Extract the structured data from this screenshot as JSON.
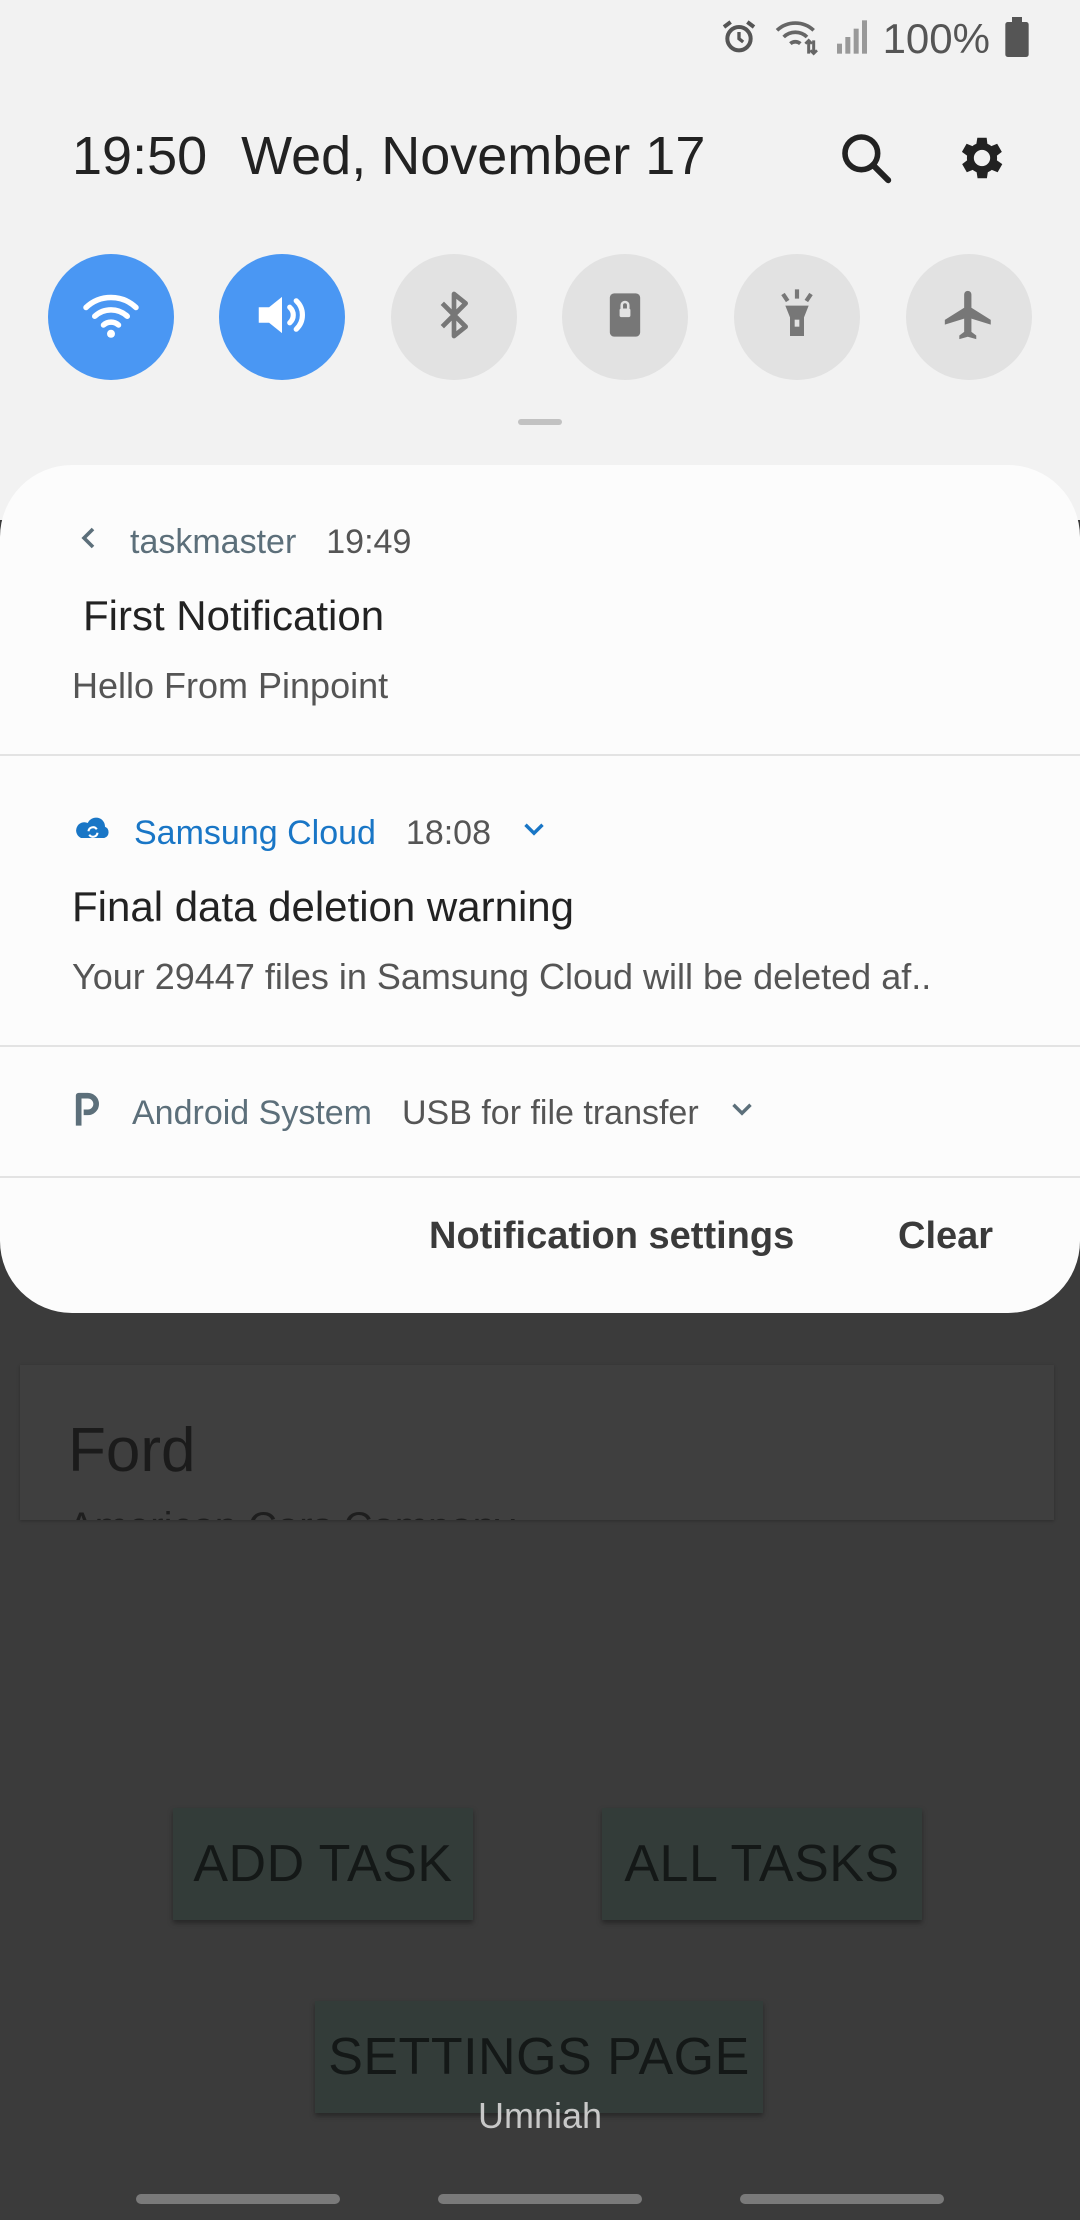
{
  "status": {
    "battery": "100%"
  },
  "header": {
    "time": "19:50",
    "date": "Wed, November 17"
  },
  "quick_settings": [
    {
      "name": "wifi",
      "state": "on"
    },
    {
      "name": "sound",
      "state": "on"
    },
    {
      "name": "bluetooth",
      "state": "off"
    },
    {
      "name": "portrait-lock",
      "state": "off"
    },
    {
      "name": "flashlight",
      "state": "off"
    },
    {
      "name": "airplane-mode",
      "state": "off"
    }
  ],
  "notifications": [
    {
      "app": "taskmaster",
      "time": "19:49",
      "title": "First Notification",
      "body": "Hello From Pinpoint"
    },
    {
      "app": "Samsung Cloud",
      "time": "18:08",
      "title": "Final data deletion warning",
      "body": "Your 29447 files in Samsung Cloud will be deleted af.."
    },
    {
      "app": "Android System",
      "text": "USB for file transfer"
    }
  ],
  "actions": {
    "settings": "Notification settings",
    "clear": "Clear"
  },
  "background_app": {
    "card_title": "Ford",
    "card_subtitle": "American Cars Company",
    "buttons": {
      "add": "ADD TASK",
      "all": "ALL TASKS",
      "settings": "SETTINGS PAGE"
    },
    "footer": "Umniah"
  },
  "colors": {
    "accent": "#4a97f3",
    "samsung_blue": "#1976c6",
    "app_gray": "#5c6f7a"
  }
}
